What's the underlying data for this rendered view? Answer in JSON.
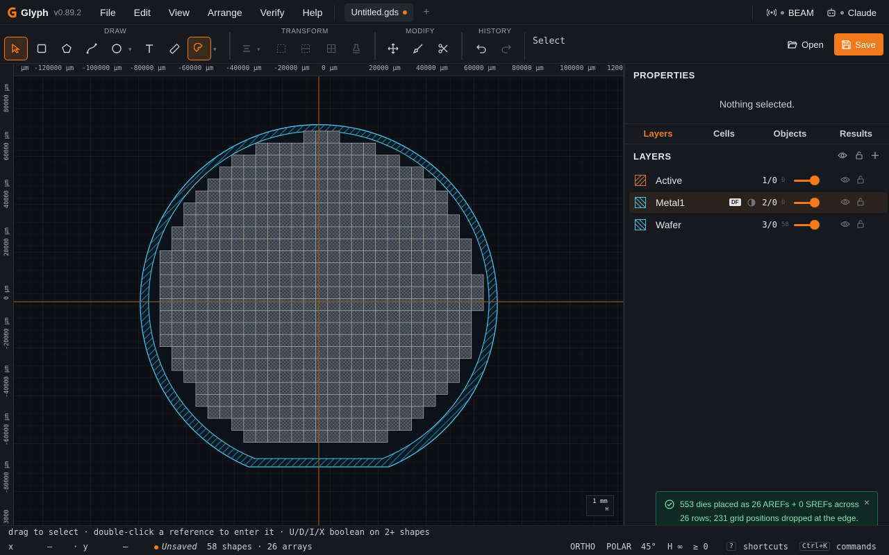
{
  "app": {
    "name": "Glyph",
    "version": "v0.89.2"
  },
  "menu": [
    "File",
    "Edit",
    "View",
    "Arrange",
    "Verify",
    "Help"
  ],
  "document_tab": {
    "title": "Untitled.gds",
    "add": "+"
  },
  "status_right": {
    "beam": "BEAM",
    "claude": "Claude"
  },
  "toolbar": {
    "groups": {
      "draw": "DRAW",
      "transform": "TRANSFORM",
      "modify": "MODIFY",
      "history": "HISTORY"
    },
    "tool_status": "Select",
    "open_label": "Open",
    "save_label": "Save"
  },
  "rulers": {
    "top": [
      "μm",
      "-120000 μm",
      "-100000 μm",
      "-80000 μm",
      "-60000 μm",
      "-40000 μm",
      "-20000 μm",
      "0 μm",
      "20000 μm",
      "40000 μm",
      "60000 μm",
      "80000 μm",
      "100000 μm",
      "1200"
    ],
    "left": [
      "80000 μm",
      "60000 μm",
      "40000 μm",
      "20000 μm",
      "0 μm",
      "-20000 μm",
      "-40000 μm",
      "-60000 μm",
      "-80000 μm",
      "3000"
    ]
  },
  "scale_badge": {
    "value": "1 mm",
    "mark": "H"
  },
  "colors": {
    "accent": "#f27a1a",
    "wafer": "#4cc3ea",
    "die": "#9a9a9a",
    "canvas": "#0c0f13"
  },
  "panel": {
    "title": "PROPERTIES",
    "empty_text": "Nothing selected.",
    "tabs": [
      "Layers",
      "Cells",
      "Objects",
      "Results"
    ],
    "layers_title": "LAYERS",
    "layers": [
      {
        "name": "Active",
        "count": "1/0",
        "extra": "0",
        "badge": ""
      },
      {
        "name": "Metal1",
        "count": "2/0",
        "extra": "0",
        "badge": "DF"
      },
      {
        "name": "Wafer",
        "count": "3/0",
        "extra": "58",
        "badge": ""
      }
    ]
  },
  "toast": {
    "message": "553 dies placed as 26 AREFs + 0 SREFs across 26 rows; 231 grid positions dropped at the edge.",
    "close": "×"
  },
  "hint": "drag to select · double-click a reference to enter it · U/D/I/X boolean on 2+ shapes",
  "footer": {
    "x_label": "x",
    "x_value": "—",
    "y_label": "· y",
    "y_value": "—",
    "unsaved": "Unsaved",
    "shapes": "58 shapes · 26 arrays",
    "ortho": "ORTHO",
    "polar": "POLAR",
    "angle": "45°",
    "h": "H ∞",
    "ge": "≥ 0",
    "shortcuts_key": "?",
    "shortcuts": "shortcuts",
    "commands_key": "Ctrl+K",
    "commands": "commands"
  }
}
